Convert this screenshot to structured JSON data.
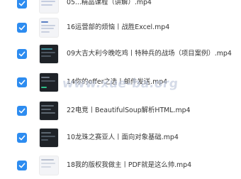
{
  "files": [
    {
      "name": "05...精品课程（讲解）.mp4",
      "checked": true
    },
    {
      "name": "16运营部的烦恼丨战胜Excel.mp4",
      "checked": true
    },
    {
      "name": "09大吉大利今晚吃鸡丨特种兵的战场（项目案例）.mp4",
      "checked": true
    },
    {
      "name": "14你的offer之选丨邮件发送.mp4",
      "checked": true
    },
    {
      "name": "22电竞丨BeautifulSoup解析HTML.mp4",
      "checked": true
    },
    {
      "name": "10龙珠之赛亚人丨面向对象基础.mp4",
      "checked": true
    },
    {
      "name": "18我的版权我做主丨PDF就是这么帅.mp4",
      "checked": true
    }
  ],
  "watermark": "www.xue-ba.org",
  "colors": {
    "checkbox": "#2d8cf0",
    "text": "#333333"
  }
}
